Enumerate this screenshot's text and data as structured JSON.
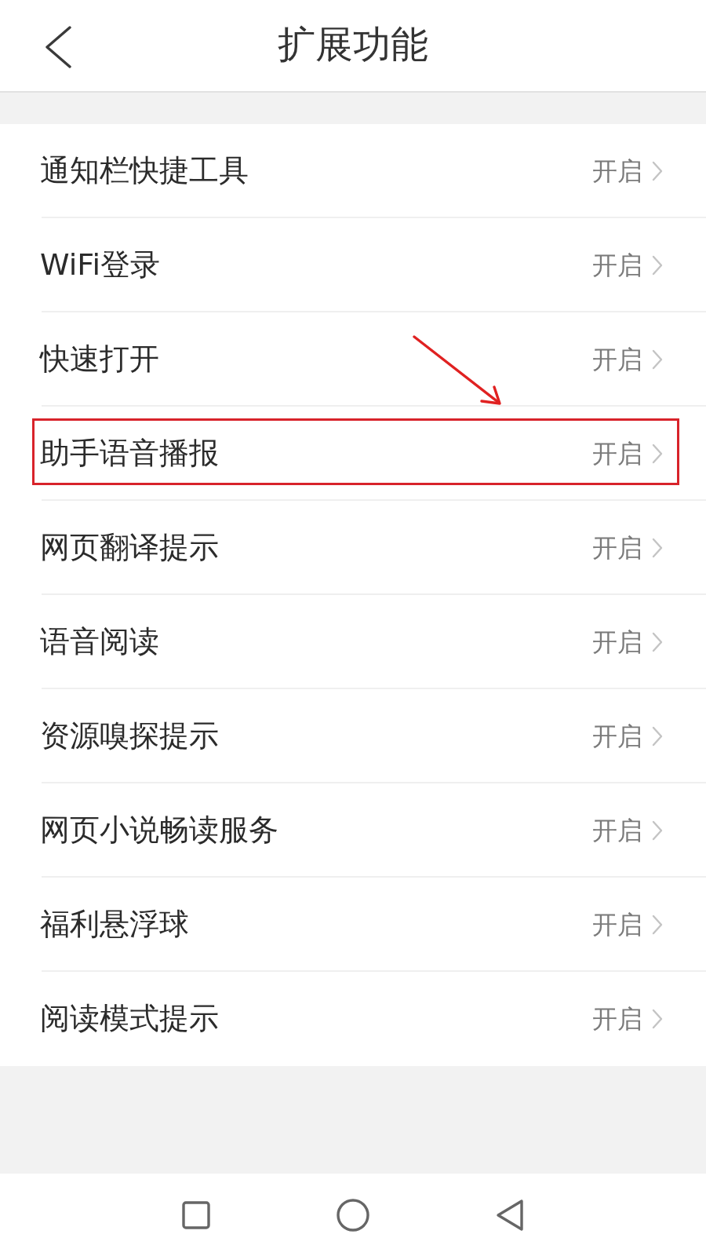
{
  "header": {
    "title": "扩展功能"
  },
  "settings": [
    {
      "label": "通知栏快捷工具",
      "value": "开启",
      "highlighted": false
    },
    {
      "label": "WiFi登录",
      "value": "开启",
      "highlighted": false
    },
    {
      "label": "快速打开",
      "value": "开启",
      "highlighted": false
    },
    {
      "label": "助手语音播报",
      "value": "开启",
      "highlighted": true
    },
    {
      "label": "网页翻译提示",
      "value": "开启",
      "highlighted": false
    },
    {
      "label": "语音阅读",
      "value": "开启",
      "highlighted": false
    },
    {
      "label": "资源嗅探提示",
      "value": "开启",
      "highlighted": false
    },
    {
      "label": "网页小说畅读服务",
      "value": "开启",
      "highlighted": false
    },
    {
      "label": "福利悬浮球",
      "value": "开启",
      "highlighted": false
    },
    {
      "label": "阅读模式提示",
      "value": "开启",
      "highlighted": false
    }
  ]
}
